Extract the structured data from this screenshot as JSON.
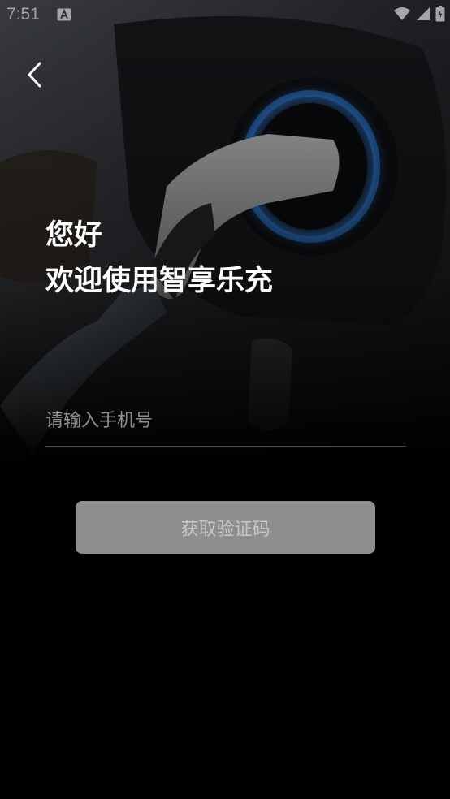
{
  "status_bar": {
    "time": "7:51",
    "icons": [
      "accessibility-a-icon",
      "wifi-icon",
      "signal-icon",
      "battery-icon"
    ]
  },
  "header": {
    "back_icon": "chevron-left-icon"
  },
  "greeting": {
    "line1": "您好",
    "line2": "欢迎使用智享乐充"
  },
  "phone_input": {
    "value": "",
    "placeholder": "请输入手机号"
  },
  "actions": {
    "get_code_label": "获取验证码"
  },
  "colors": {
    "background": "#000000",
    "text": "#ffffff",
    "button_disabled_bg": "#8e8e8e",
    "button_disabled_text": "#c7c7c7",
    "charger_ring_accent": "#2f7fd8"
  }
}
